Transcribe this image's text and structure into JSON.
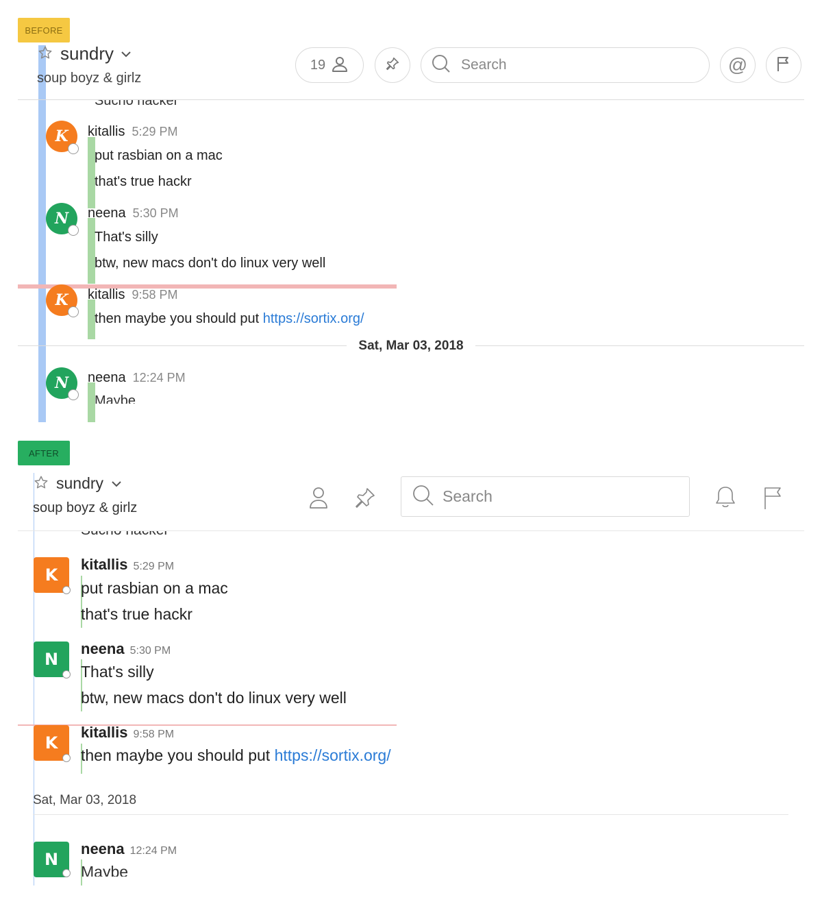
{
  "labels": {
    "before": "BEFORE",
    "after": "AFTER"
  },
  "before": {
    "channel": {
      "name": "sundry",
      "purpose": "soup boyz & girlz"
    },
    "members_count": "19",
    "search_placeholder": "Search",
    "at_symbol": "@",
    "clipped_top_text": "Sucho hacker",
    "date_separator": "Sat, Mar 03, 2018",
    "messages": [
      {
        "initial": "K",
        "sender": "kitallis",
        "time": "5:29 PM",
        "lines": [
          "put rasbian on a mac",
          "that's true hackr"
        ]
      },
      {
        "initial": "N",
        "sender": "neena",
        "time": "5:30 PM",
        "lines": [
          "That's silly",
          "btw, new macs don't do linux very well"
        ]
      },
      {
        "initial": "K",
        "sender": "kitallis",
        "time": "9:58 PM",
        "text": "then maybe you should put ",
        "link": "https://sortix.org/"
      },
      {
        "initial": "N",
        "sender": "neena",
        "time": "12:24 PM",
        "text": "Maybe"
      }
    ]
  },
  "after": {
    "channel": {
      "name": "sundry",
      "purpose": "soup boyz & girlz"
    },
    "search_placeholder": "Search",
    "clipped_top_text": "Sucho hacker",
    "date_separator": "Sat, Mar 03, 2018",
    "messages": [
      {
        "initial": "K",
        "sender": "kitallis",
        "time": "5:29 PM",
        "lines": [
          "put rasbian on a mac",
          "that's true hackr"
        ]
      },
      {
        "initial": "N",
        "sender": "neena",
        "time": "5:30 PM",
        "lines": [
          "That's silly",
          "btw, new macs don't do linux very well"
        ]
      },
      {
        "initial": "K",
        "sender": "kitallis",
        "time": "9:58 PM",
        "text": "then maybe you should put ",
        "link": "https://sortix.org/"
      },
      {
        "initial": "N",
        "sender": "neena",
        "time": "12:24 PM",
        "text": "Maybe"
      }
    ]
  },
  "colors": {
    "orange_avatar": "#f57c1f",
    "green_avatar": "#22a45d",
    "link": "#2a7bd6",
    "new_message_line": "#f2b6b6",
    "blue_marker": "#a9c9f5",
    "green_marker": "#a9d8a4"
  }
}
